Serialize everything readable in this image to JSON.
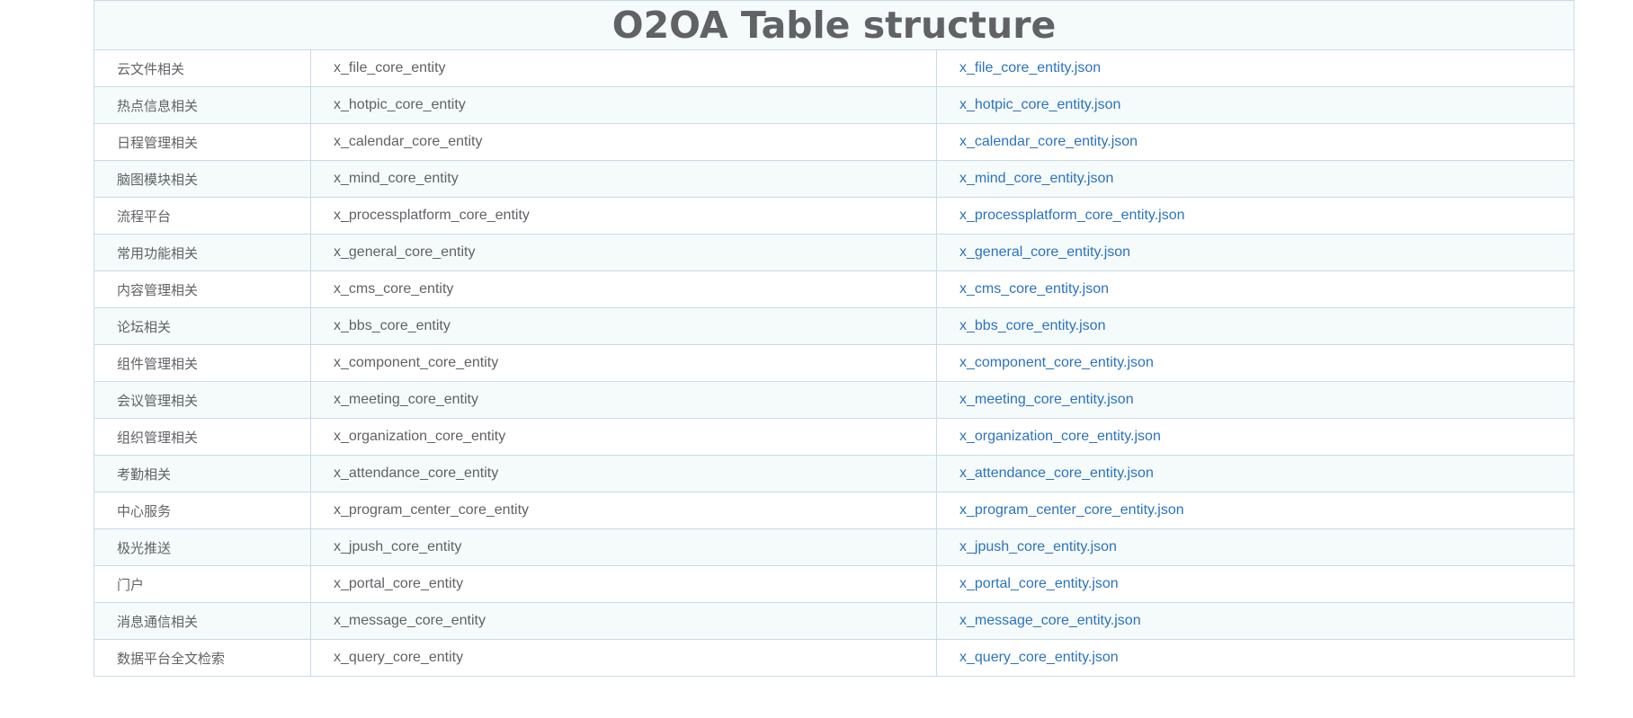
{
  "page": {
    "title": "O2OA Table structure"
  },
  "rows": [
    {
      "module": "云文件相关",
      "entity": "x_file_core_entity",
      "json": "x_file_core_entity.json"
    },
    {
      "module": "热点信息相关",
      "entity": "x_hotpic_core_entity",
      "json": "x_hotpic_core_entity.json"
    },
    {
      "module": "日程管理相关",
      "entity": "x_calendar_core_entity",
      "json": "x_calendar_core_entity.json"
    },
    {
      "module": "脑图模块相关",
      "entity": "x_mind_core_entity",
      "json": "x_mind_core_entity.json"
    },
    {
      "module": "流程平台",
      "entity": "x_processplatform_core_entity",
      "json": "x_processplatform_core_entity.json"
    },
    {
      "module": "常用功能相关",
      "entity": "x_general_core_entity",
      "json": "x_general_core_entity.json"
    },
    {
      "module": "内容管理相关",
      "entity": "x_cms_core_entity",
      "json": "x_cms_core_entity.json"
    },
    {
      "module": "论坛相关",
      "entity": "x_bbs_core_entity",
      "json": "x_bbs_core_entity.json"
    },
    {
      "module": "组件管理相关",
      "entity": "x_component_core_entity",
      "json": "x_component_core_entity.json"
    },
    {
      "module": "会议管理相关",
      "entity": "x_meeting_core_entity",
      "json": "x_meeting_core_entity.json"
    },
    {
      "module": "组织管理相关",
      "entity": "x_organization_core_entity",
      "json": "x_organization_core_entity.json"
    },
    {
      "module": "考勤相关",
      "entity": "x_attendance_core_entity",
      "json": "x_attendance_core_entity.json"
    },
    {
      "module": "中心服务",
      "entity": "x_program_center_core_entity",
      "json": "x_program_center_core_entity.json"
    },
    {
      "module": "极光推送",
      "entity": "x_jpush_core_entity",
      "json": "x_jpush_core_entity.json"
    },
    {
      "module": "门户",
      "entity": "x_portal_core_entity",
      "json": "x_portal_core_entity.json"
    },
    {
      "module": "消息通信相关",
      "entity": "x_message_core_entity",
      "json": "x_message_core_entity.json"
    },
    {
      "module": "数据平台全文检索",
      "entity": "x_query_core_entity",
      "json": "x_query_core_entity.json"
    }
  ],
  "colors": {
    "border": "#c9dbe8",
    "stripe": "#f5fafa",
    "text": "#606266",
    "link": "#2a73c1"
  }
}
